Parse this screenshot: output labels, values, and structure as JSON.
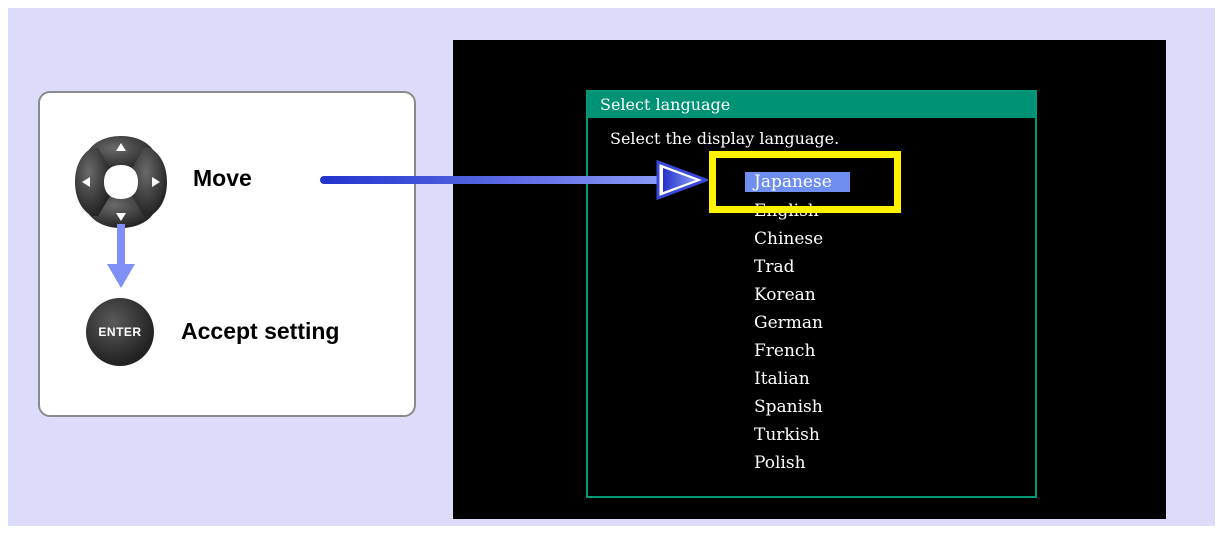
{
  "controls": {
    "move_label": "Move",
    "accept_label": "Accept setting",
    "enter_key_label": "ENTER",
    "dpad_icon": "cursor-keys-icon",
    "arrow_color": "#3344dd"
  },
  "dialog": {
    "title": "Select language",
    "prompt": "Select the display language.",
    "selected": "Japanese",
    "languages": [
      "Japanese",
      "English",
      "Chinese",
      "Trad",
      "Korean",
      "German",
      "French",
      "Italian",
      "Spanish",
      "Turkish",
      "Polish"
    ],
    "title_bar_color": "#009275",
    "highlight_color": "#6e8ef0"
  },
  "callout": {
    "highlight_box_color": "#fff200"
  }
}
